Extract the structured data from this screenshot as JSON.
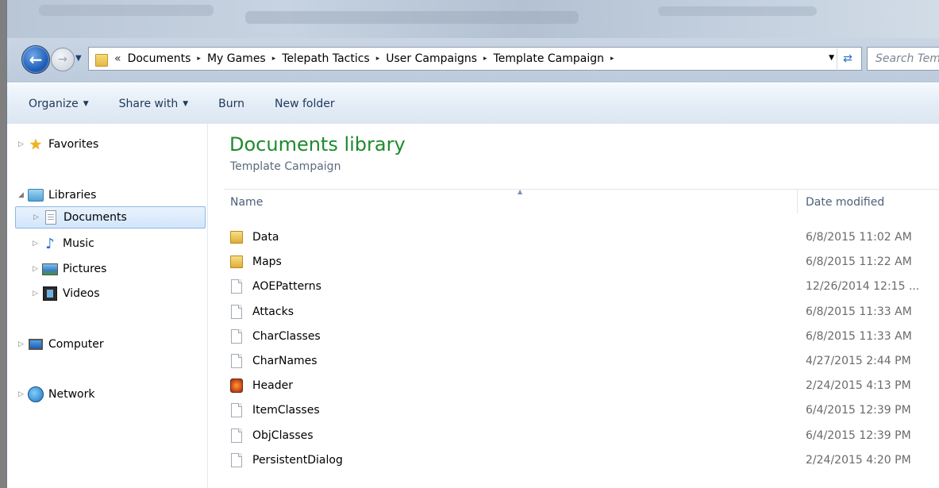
{
  "window": {
    "address": {
      "lead": "«",
      "crumbs": [
        "Documents",
        "My Games",
        "Telepath Tactics",
        "User Campaigns",
        "Template Campaign"
      ],
      "separator": "▸",
      "dropdown_icon": "chevron-down-icon",
      "refresh_icon": "refresh-icon"
    },
    "search_placeholder": "Search Temp"
  },
  "toolbar": {
    "organize": "Organize",
    "share_with": "Share with",
    "burn": "Burn",
    "new_folder": "New folder"
  },
  "nav": {
    "favorites": "Favorites",
    "libraries": "Libraries",
    "documents": "Documents",
    "music": "Music",
    "pictures": "Pictures",
    "videos": "Videos",
    "computer": "Computer",
    "network": "Network"
  },
  "content": {
    "library_title": "Documents library",
    "library_subtitle": "Template Campaign",
    "columns": {
      "name": "Name",
      "date": "Date modified"
    },
    "files": [
      {
        "name": "Data",
        "date": "6/8/2015 11:02 AM",
        "type": "folder"
      },
      {
        "name": "Maps",
        "date": "6/8/2015 11:22 AM",
        "type": "folder"
      },
      {
        "name": "AOEPatterns",
        "date": "12/26/2014 12:15 ...",
        "type": "file"
      },
      {
        "name": "Attacks",
        "date": "6/8/2015 11:33 AM",
        "type": "file"
      },
      {
        "name": "CharClasses",
        "date": "6/8/2015 11:33 AM",
        "type": "file"
      },
      {
        "name": "CharNames",
        "date": "4/27/2015 2:44 PM",
        "type": "file"
      },
      {
        "name": "Header",
        "date": "2/24/2015 4:13 PM",
        "type": "image"
      },
      {
        "name": "ItemClasses",
        "date": "6/4/2015 12:39 PM",
        "type": "file"
      },
      {
        "name": "ObjClasses",
        "date": "6/4/2015 12:39 PM",
        "type": "file"
      },
      {
        "name": "PersistentDialog",
        "date": "2/24/2015 4:20 PM",
        "type": "file"
      }
    ]
  },
  "colors": {
    "library_title": "#1e8a2e",
    "selection": "#d3e6fb",
    "command_text": "#1e395b"
  }
}
